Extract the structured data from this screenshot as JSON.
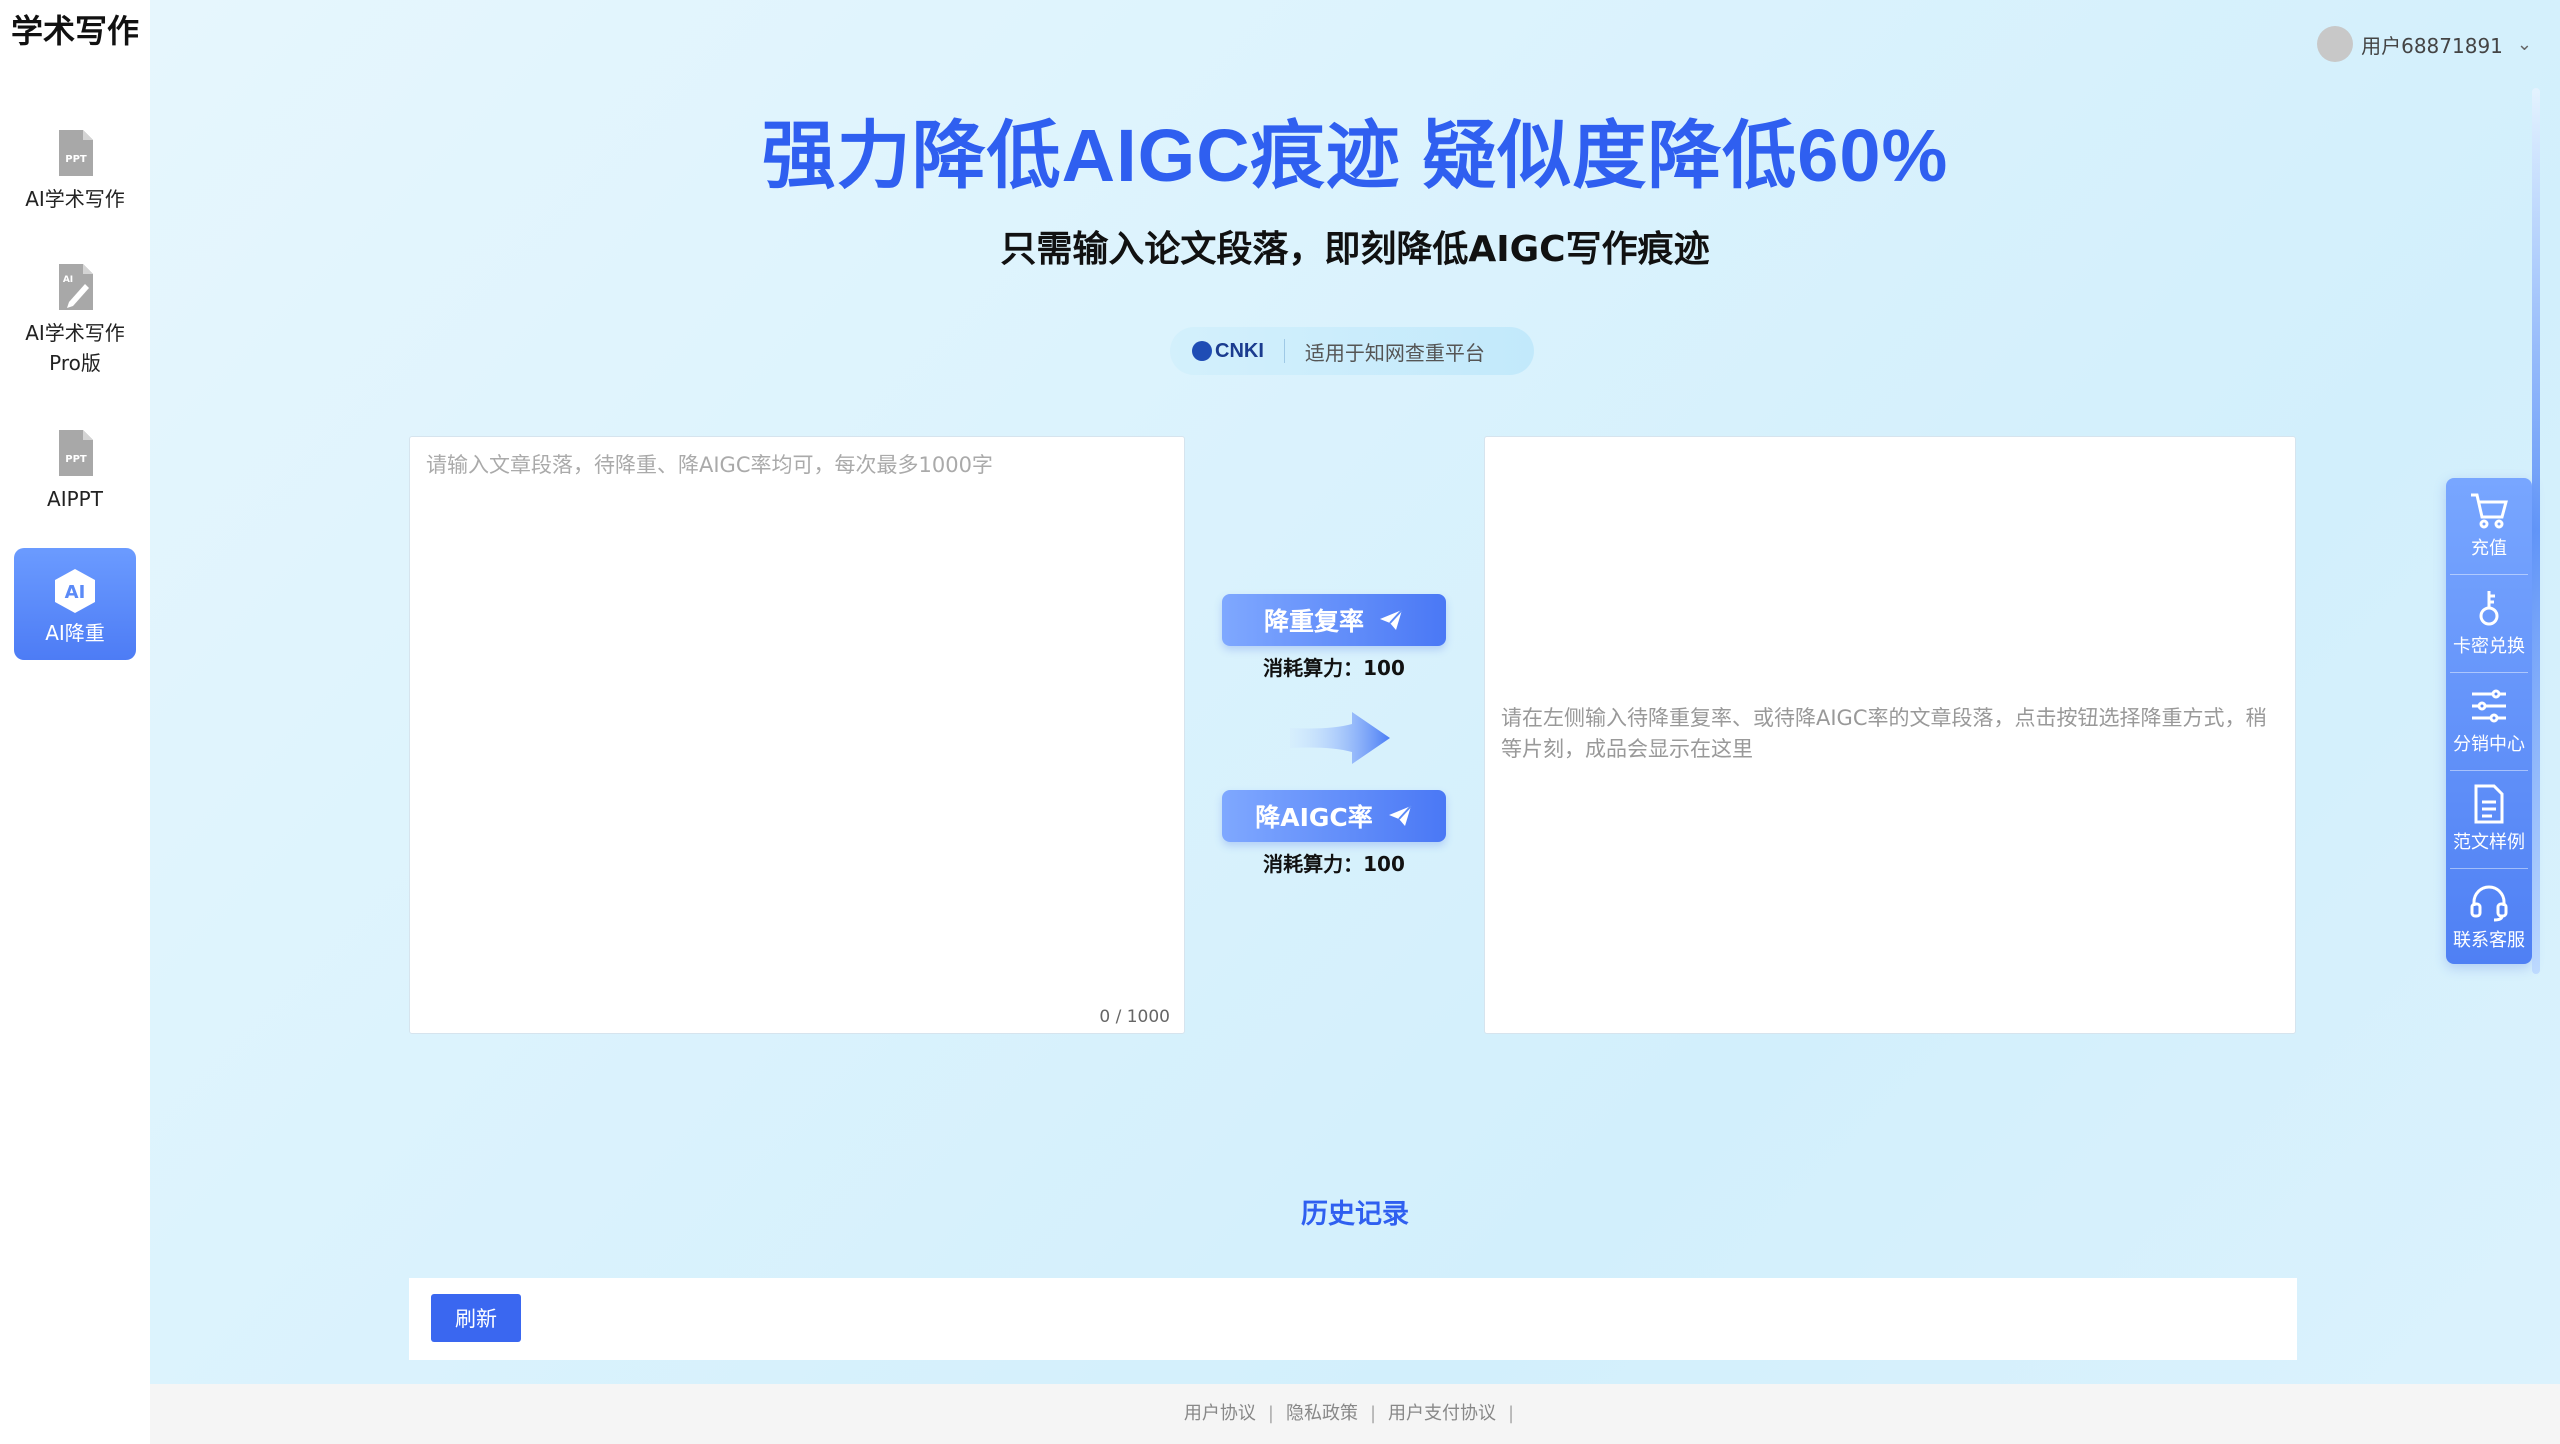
{
  "sidebar": {
    "brand": "学术写作",
    "items": [
      {
        "label": "AI学术写作",
        "icon": "ppt-file-icon"
      },
      {
        "label": "AI学术写作Pro版",
        "icon": "ai-edit-icon"
      },
      {
        "label": "AIPPT",
        "icon": "ppt-file-icon"
      },
      {
        "label": "AI降重",
        "icon": "ai-hexagon-icon",
        "active": true
      }
    ]
  },
  "header": {
    "username": "用户68871891"
  },
  "hero": {
    "title": "强力降低AIGC痕迹 疑似度降低60%",
    "subtitle": "只需输入论文段落，即刻降低AIGC写作痕迹",
    "platform_logo": "CNKI",
    "platform_text": "适用于知网查重平台"
  },
  "input": {
    "placeholder": "请输入文章段落，待降重、降AIGC率均可，每次最多1000字",
    "value": "",
    "counter": "0 / 1000"
  },
  "actions": [
    {
      "label": "降重复率",
      "cost": "消耗算力：100"
    },
    {
      "label": "降AIGC率",
      "cost": "消耗算力：100"
    }
  ],
  "output": {
    "hint": "请在左侧输入待降重复率、或待降AIGC率的文章段落，点击按钮选择降重方式，稍等片刻，成品会显示在这里"
  },
  "history": {
    "title": "历史记录",
    "refresh_label": "刷新"
  },
  "toolbar": [
    {
      "label": "充值",
      "icon": "cart-icon"
    },
    {
      "label": "卡密兑换",
      "icon": "key-icon"
    },
    {
      "label": "分销中心",
      "icon": "sliders-icon"
    },
    {
      "label": "范文样例",
      "icon": "document-icon"
    },
    {
      "label": "联系客服",
      "icon": "headset-icon"
    }
  ],
  "footer": {
    "links": [
      "用户协议",
      "隐私政策",
      "用户支付协议"
    ]
  },
  "colors": {
    "accent": "#2f5ff0",
    "button_gradient_start": "#7fa8ff",
    "button_gradient_end": "#4a78f5",
    "background": "#dcf3fd"
  }
}
